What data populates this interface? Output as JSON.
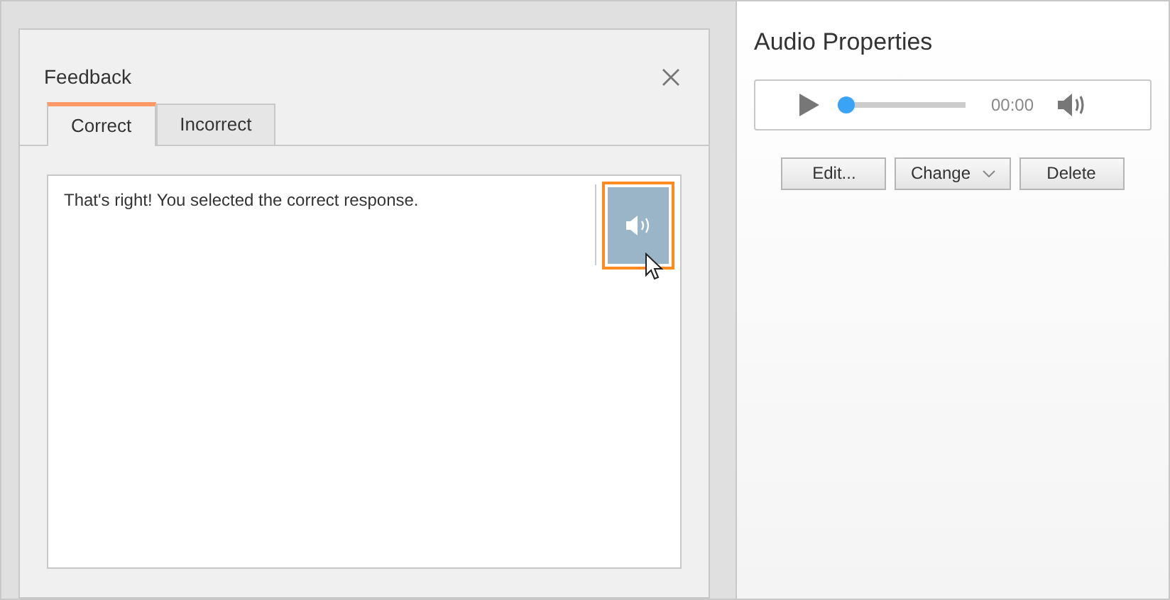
{
  "dialog": {
    "title": "Feedback",
    "tabs": [
      {
        "label": "Correct",
        "selected": true
      },
      {
        "label": "Incorrect",
        "selected": false
      }
    ],
    "feedback_text": "That's right! You selected the correct response.",
    "audio_button": {
      "selected": true
    }
  },
  "audio_properties": {
    "title": "Audio Properties",
    "player": {
      "level": 0,
      "time": "00:00"
    },
    "buttons": [
      {
        "label": "Edit...",
        "kind": "plain"
      },
      {
        "label": "Change",
        "kind": "dropdown"
      },
      {
        "label": "Delete",
        "kind": "plain"
      }
    ]
  }
}
